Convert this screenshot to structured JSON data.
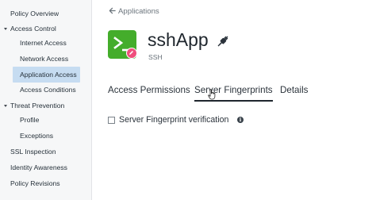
{
  "sidebar": {
    "items": [
      {
        "label": "Policy Overview"
      },
      {
        "label": "Access Control"
      },
      {
        "label": "Internet Access"
      },
      {
        "label": "Network Access"
      },
      {
        "label": "Application Access"
      },
      {
        "label": "Access Conditions"
      },
      {
        "label": "Threat Prevention"
      },
      {
        "label": "Profile"
      },
      {
        "label": "Exceptions"
      },
      {
        "label": "SSL Inspection"
      },
      {
        "label": "Identity Awareness"
      },
      {
        "label": "Policy Revisions"
      }
    ],
    "selected_index": 4
  },
  "header": {
    "back_label": "Applications",
    "app_name": "sshApp",
    "app_type": "SSH",
    "app_icon": "terminal-prompt-icon",
    "status_icon": "plug-icon"
  },
  "tabs": [
    {
      "label": "Access Permissions",
      "active": false
    },
    {
      "label": "Server Fingerprints",
      "active": true
    },
    {
      "label": "Details",
      "active": false
    }
  ],
  "content": {
    "checkbox_label": "Server Fingerprint verification",
    "checkbox_checked": false,
    "info_glyph": "i"
  },
  "colors": {
    "app_icon_bg": "#44ad2b",
    "edit_badge": "#ef4f7c",
    "sidebar_selected": "#c6dcf1",
    "sidebar_bg": "#f6f7f8"
  }
}
